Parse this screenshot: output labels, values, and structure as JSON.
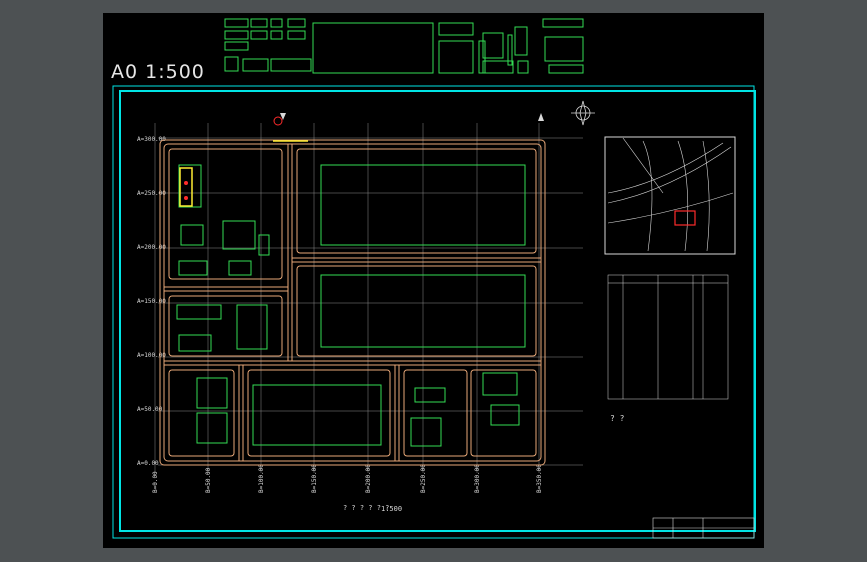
{
  "window": {
    "background": "#4d5153",
    "canvas_background": "#000000"
  },
  "drawing": {
    "scale_label": "A0 1:500",
    "plan_title": "? ? ? ? ? ?",
    "plan_scale": "1:500"
  },
  "colors": {
    "frame": "#00e5e5",
    "road": "#e8a878",
    "building": "#33dd55",
    "grid": "#8c8c8c",
    "text": "#d9d9d9",
    "marker": "#ff2b2b",
    "highlight": "#ffee33"
  },
  "grid": {
    "row_labels": [
      "A=300.00",
      "A=250.00",
      "A=200.00",
      "A=150.00",
      "A=100.00",
      "A=50.00",
      "A=0.00"
    ],
    "col_labels": [
      "B=0.00",
      "B=50.00",
      "B=100.00",
      "B=150.00",
      "B=200.00",
      "B=250.00",
      "B=300.00",
      "B=350.00"
    ]
  },
  "notes": {
    "heading": "? ?"
  },
  "icons": [
    "north-arrow-icon",
    "location-pin-icon",
    "benchmark-triangle-icon"
  ]
}
